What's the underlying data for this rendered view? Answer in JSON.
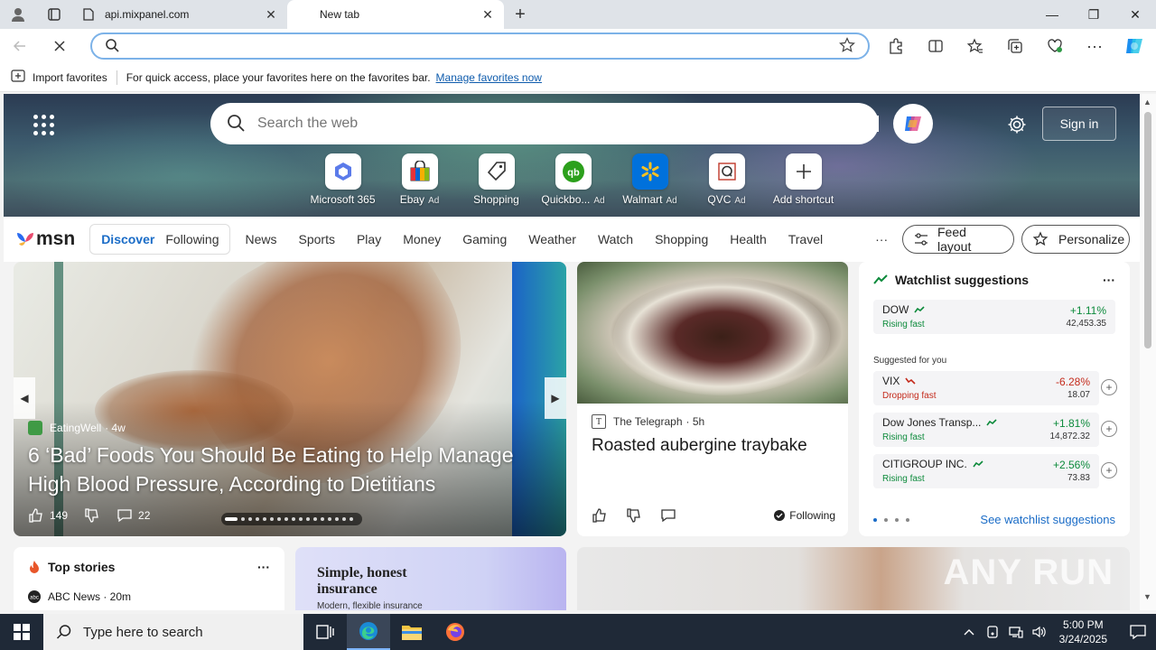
{
  "browser": {
    "tabs": [
      {
        "title": "api.mixpanel.com",
        "active": false
      },
      {
        "title": "New tab",
        "active": true
      }
    ],
    "address": {
      "value": "",
      "placeholder": ""
    },
    "favorites_bar": {
      "import_label": "Import favorites",
      "message": "For quick access, place your favorites here on the favorites bar.",
      "manage_link": "Manage favorites now"
    }
  },
  "newtab": {
    "search_placeholder": "Search the web",
    "sign_in": "Sign in",
    "shortcuts": [
      {
        "label": "Microsoft 365",
        "ad": "",
        "icon": "m365-icon"
      },
      {
        "label": "Ebay",
        "ad": "Ad",
        "icon": "ebay-icon"
      },
      {
        "label": "Shopping",
        "ad": "",
        "icon": "shopping-tag-icon"
      },
      {
        "label": "Quickbo...",
        "ad": "Ad",
        "icon": "quickbooks-icon"
      },
      {
        "label": "Walmart",
        "ad": "Ad",
        "icon": "walmart-icon"
      },
      {
        "label": "QVC",
        "ad": "Ad",
        "icon": "qvc-icon"
      },
      {
        "label": "Add shortcut",
        "ad": "",
        "icon": "plus-icon"
      }
    ]
  },
  "msn": {
    "logo_text": "msn",
    "segments": [
      "Discover",
      "Following"
    ],
    "nav": [
      "News",
      "Sports",
      "Play",
      "Money",
      "Gaming",
      "Weather",
      "Watch",
      "Shopping",
      "Health",
      "Travel"
    ],
    "more": "···",
    "feed_layout": "Feed layout",
    "personalize": "Personalize"
  },
  "hero_article": {
    "source": "EatingWell",
    "age": "· 4w",
    "headline": "6 ‘Bad’ Foods You Should Be Eating to Help Manage High Blood Pressure, According to Dietitians",
    "likes": "149",
    "comments": "22"
  },
  "side_article": {
    "source": "The Telegraph",
    "age": "· 5h",
    "title": "Roasted aubergine traybake",
    "following": "Following"
  },
  "watchlist": {
    "title": "Watchlist suggestions",
    "more": "···",
    "primary": {
      "name": "DOW",
      "status": "Rising fast",
      "change": "+1.11%",
      "value": "42,453.35",
      "dir": "up"
    },
    "suggested_label": "Suggested for you",
    "suggested": [
      {
        "name": "VIX",
        "status": "Dropping fast",
        "change": "-6.28%",
        "value": "18.07",
        "dir": "down"
      },
      {
        "name": "Dow Jones Transp...",
        "status": "Rising fast",
        "change": "+1.81%",
        "value": "14,872.32",
        "dir": "up"
      },
      {
        "name": "CITIGROUP INC.",
        "status": "Rising fast",
        "change": "+2.56%",
        "value": "73.83",
        "dir": "up"
      }
    ],
    "see_more": "See watchlist suggestions"
  },
  "top_stories": {
    "title": "Top stories",
    "more": "···",
    "first_item": "ABC News · 20m"
  },
  "ad_card": {
    "headline": "Simple, honest insurance",
    "sub": "Modern, flexible insurance"
  },
  "watermark": "ANY RUN",
  "taskbar": {
    "search_placeholder": "Type here to search",
    "time": "5:00 PM",
    "date": "3/24/2025"
  },
  "colors": {
    "accent": "#1a6cc7",
    "up": "#0c8a3b",
    "down": "#c42b1c",
    "taskbar": "#1f2937"
  }
}
